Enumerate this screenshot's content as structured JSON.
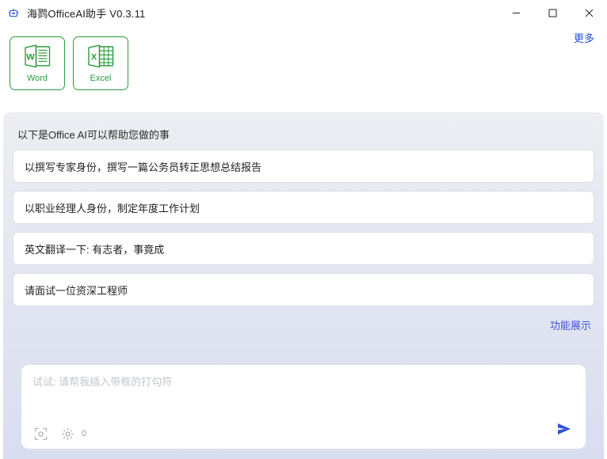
{
  "window": {
    "title": "海鹨OfficeAI助手 V0.3.11",
    "app_icon": "robot-icon",
    "controls": {
      "minimize": "minimize-icon",
      "maximize": "maximize-icon",
      "close": "close-icon"
    }
  },
  "launchbar": {
    "tiles": [
      {
        "label": "Word",
        "icon": "word-icon",
        "accent": "#2d9a3e"
      },
      {
        "label": "Excel",
        "icon": "excel-icon",
        "accent": "#2d9a3e"
      }
    ],
    "more_label": "更多"
  },
  "content": {
    "section_title": "以下是Office AI可以帮助您做的事",
    "suggestions": [
      {
        "text": "以撰写专家身份，撰写一篇公务员转正思想总结报告"
      },
      {
        "text": "以职业经理人身份，制定年度工作计划"
      },
      {
        "text": "英文翻译一下: 有志者，事竟成"
      },
      {
        "text": "请面试一位资深工程师"
      }
    ],
    "demo_link": "功能展示"
  },
  "composer": {
    "value": "",
    "placeholder": "试试: 请帮我插入带框的打勾符",
    "tools": [
      {
        "name": "screenshot-icon"
      },
      {
        "name": "gear-icon"
      }
    ],
    "token_count": "0",
    "send_icon": "send-icon"
  },
  "colors": {
    "accent_green": "#2d9a3e",
    "link_blue": "#1d4fd8",
    "demo_blue": "#3f51d6",
    "send_blue": "#2d55d8",
    "panel_top": "#eceef2",
    "panel_bottom": "#d9ddf0"
  }
}
